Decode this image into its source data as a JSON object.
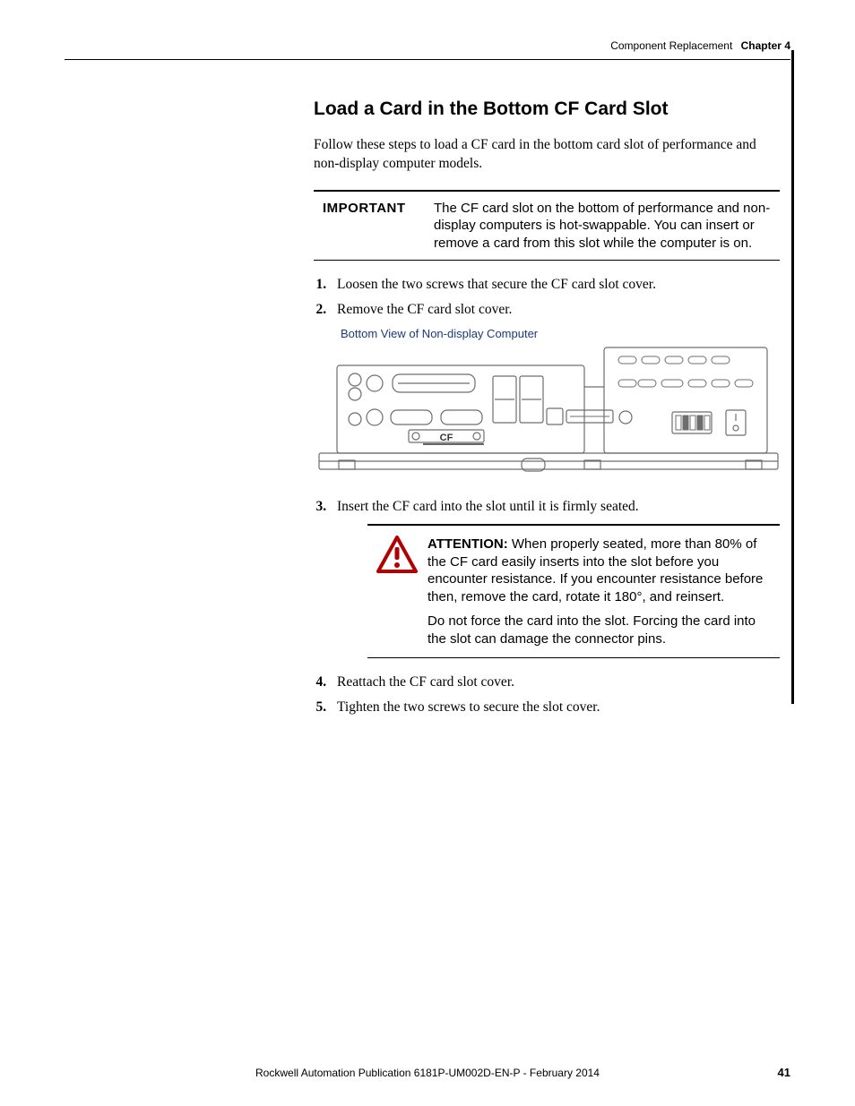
{
  "header": {
    "section": "Component Replacement",
    "chapter": "Chapter 4"
  },
  "subhead": "Load a Card in the Bottom CF Card Slot",
  "lead": "Follow these steps to load a CF card in the bottom card slot of performance and non-display computer models.",
  "important": {
    "label": "IMPORTANT",
    "text": "The CF card slot on the bottom of performance and non-display computers is hot-swappable. You can insert or remove a card from this slot while the computer is on."
  },
  "steps": {
    "s1": "Loosen the two screws that secure the CF card slot cover.",
    "s2": "Remove the CF card slot cover.",
    "s3": "Insert the CF card into the slot until it is firmly seated.",
    "s4": "Reattach the CF card slot cover.",
    "s5": "Tighten the two screws to secure the slot cover."
  },
  "figure": {
    "caption": "Bottom View of Non-display Computer",
    "cf_label": "CF"
  },
  "attention": {
    "label": "ATTENTION:",
    "para1": " When properly seated, more than 80% of the CF card easily inserts into the slot before you encounter resistance. If you encounter resistance before then, remove the card, rotate it 180°, and reinsert.",
    "para2": "Do not force the card into the slot. Forcing the card into the slot can damage the connector pins."
  },
  "footer": {
    "pub": "Rockwell Automation Publication 6181P-UM002D-EN-P - February 2014",
    "page": "41"
  },
  "icons": {
    "warning": "warning-triangle"
  }
}
